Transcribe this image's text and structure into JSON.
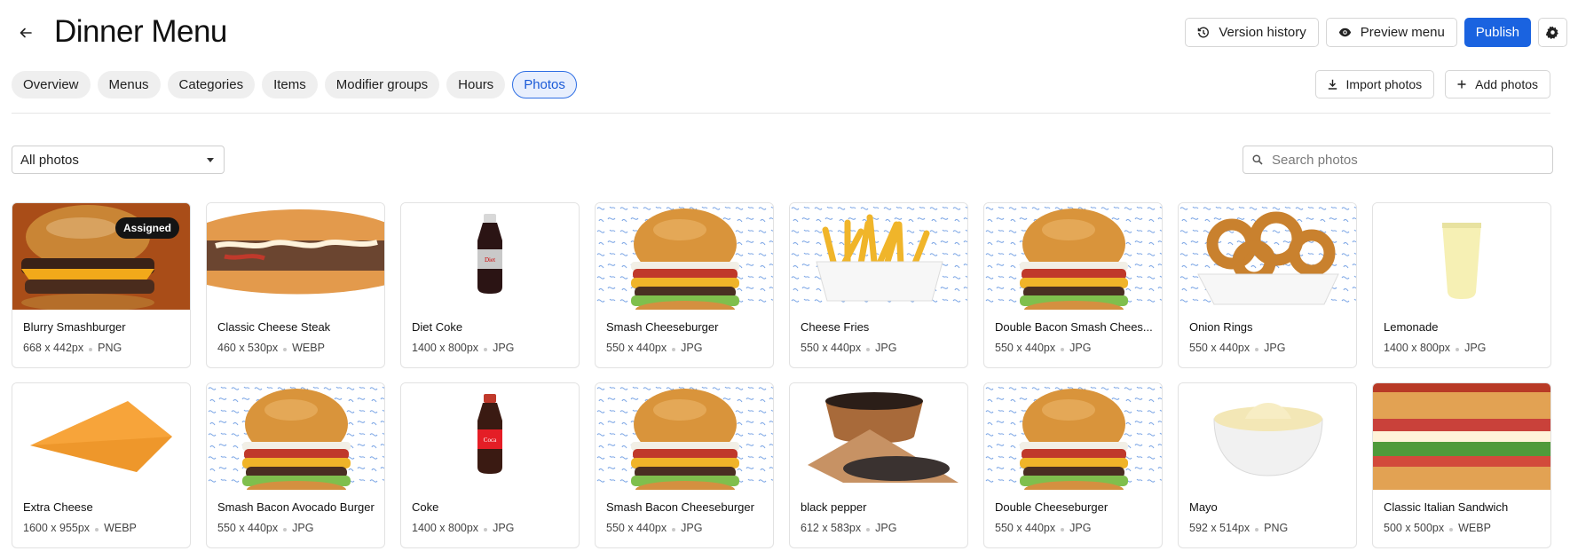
{
  "header": {
    "title": "Dinner Menu",
    "version_history": "Version history",
    "preview_menu": "Preview menu",
    "publish": "Publish"
  },
  "tabs": [
    {
      "label": "Overview",
      "active": false
    },
    {
      "label": "Menus",
      "active": false
    },
    {
      "label": "Categories",
      "active": false
    },
    {
      "label": "Items",
      "active": false
    },
    {
      "label": "Modifier groups",
      "active": false
    },
    {
      "label": "Hours",
      "active": false
    },
    {
      "label": "Photos",
      "active": true
    }
  ],
  "tab_actions": {
    "import_photos": "Import photos",
    "add_photos": "Add photos"
  },
  "filters": {
    "selected": "All photos",
    "search_placeholder": "Search photos"
  },
  "colors": {
    "accent": "#1a63e0",
    "active_tab_bg": "#e8effd"
  },
  "photos": [
    {
      "name": "Blurry Smashburger",
      "dims": "668 x 442px",
      "format": "PNG",
      "badge": "Assigned",
      "kind": "burger-dark"
    },
    {
      "name": "Classic Cheese Steak",
      "dims": "460 x 530px",
      "format": "WEBP",
      "badge": "",
      "kind": "cheesesteak"
    },
    {
      "name": "Diet Coke",
      "dims": "1400 x 800px",
      "format": "JPG",
      "badge": "",
      "kind": "diet-coke"
    },
    {
      "name": "Smash Cheeseburger",
      "dims": "550 x 440px",
      "format": "JPG",
      "badge": "",
      "kind": "burger-squig"
    },
    {
      "name": "Cheese Fries",
      "dims": "550 x 440px",
      "format": "JPG",
      "badge": "",
      "kind": "fries"
    },
    {
      "name": "Double Bacon Smash Chees...",
      "dims": "550 x 440px",
      "format": "JPG",
      "badge": "",
      "kind": "burger-squig"
    },
    {
      "name": "Onion Rings",
      "dims": "550 x 440px",
      "format": "JPG",
      "badge": "",
      "kind": "onion-rings"
    },
    {
      "name": "Lemonade",
      "dims": "1400 x 800px",
      "format": "JPG",
      "badge": "",
      "kind": "lemonade"
    },
    {
      "name": "Extra Cheese",
      "dims": "1600 x 955px",
      "format": "WEBP",
      "badge": "",
      "kind": "cheese"
    },
    {
      "name": "Smash Bacon Avocado Burger",
      "dims": "550 x 440px",
      "format": "JPG",
      "badge": "",
      "kind": "burger-squig"
    },
    {
      "name": "Coke",
      "dims": "1400 x 800px",
      "format": "JPG",
      "badge": "",
      "kind": "coke"
    },
    {
      "name": "Smash Bacon Cheeseburger",
      "dims": "550 x 440px",
      "format": "JPG",
      "badge": "",
      "kind": "burger-squig"
    },
    {
      "name": "black pepper",
      "dims": "612 x 583px",
      "format": "JPG",
      "badge": "",
      "kind": "pepper"
    },
    {
      "name": "Double Cheeseburger",
      "dims": "550 x 440px",
      "format": "JPG",
      "badge": "",
      "kind": "burger-squig"
    },
    {
      "name": "Mayo",
      "dims": "592 x 514px",
      "format": "PNG",
      "badge": "",
      "kind": "mayo"
    },
    {
      "name": "Classic Italian Sandwich",
      "dims": "500 x 500px",
      "format": "WEBP",
      "badge": "",
      "kind": "italian"
    }
  ]
}
